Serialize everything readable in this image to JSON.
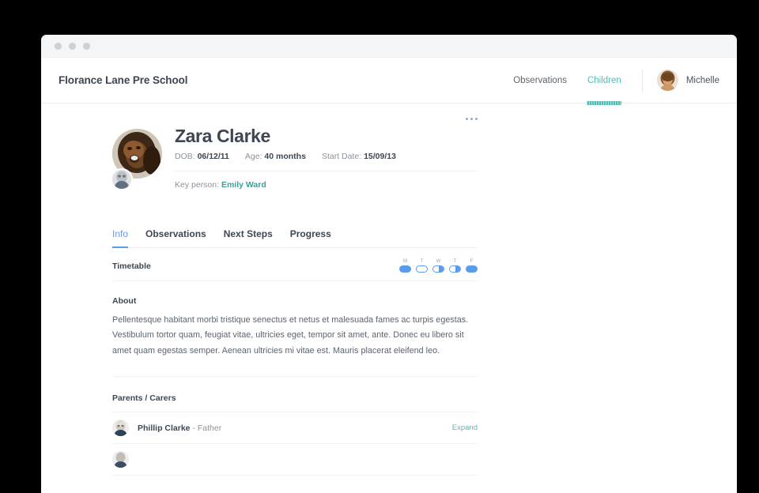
{
  "window": {
    "titlebar_dots": [
      "dot-1",
      "dot-2",
      "dot-3"
    ]
  },
  "header": {
    "brand": "Florance Lane Pre School",
    "nav": [
      {
        "label": "Observations",
        "active": false
      },
      {
        "label": "Children",
        "active": true
      }
    ],
    "user": {
      "name": "Michelle",
      "avatar": "user-avatar"
    }
  },
  "profile": {
    "name": "Zara Clarke",
    "avatar": "child-avatar",
    "badge_avatar": "child-badge-avatar",
    "meta": [
      {
        "label": "DOB:",
        "value": "06/12/11"
      },
      {
        "label": "Age:",
        "value": "40 months"
      },
      {
        "label": "Start Date:",
        "value": "15/09/13"
      }
    ],
    "key_person_label": "Key person:",
    "key_person_name": "Emily Ward",
    "more_menu": "more-options"
  },
  "tabs": [
    {
      "label": "Info",
      "active": true
    },
    {
      "label": "Observations",
      "active": false
    },
    {
      "label": "Next Steps",
      "active": false
    },
    {
      "label": "Progress",
      "active": false
    }
  ],
  "timetable": {
    "label": "Timetable",
    "days": [
      {
        "letter": "M",
        "state": "full"
      },
      {
        "letter": "T",
        "state": "empty"
      },
      {
        "letter": "W",
        "state": "half"
      },
      {
        "letter": "T",
        "state": "half"
      },
      {
        "letter": "F",
        "state": "full"
      }
    ]
  },
  "about": {
    "title": "About",
    "text": "Pellentesque habitant morbi tristique senectus et netus et malesuada fames ac turpis egestas. Vestibulum tortor quam, feugiat vitae, ultricies eget, tempor sit amet, ante. Donec eu libero sit amet quam egestas semper. Aenean ultricies mi vitae est. Mauris placerat eleifend leo."
  },
  "parents": {
    "title": "Parents / Carers",
    "rows": [
      {
        "name": "Phillip Clarke",
        "relation": " - Father",
        "action": "Expand"
      }
    ]
  },
  "colors": {
    "accent_teal": "#55b9b4",
    "accent_blue": "#5b9cea",
    "text_dark": "#3d4754",
    "text_muted": "#8b939d"
  }
}
